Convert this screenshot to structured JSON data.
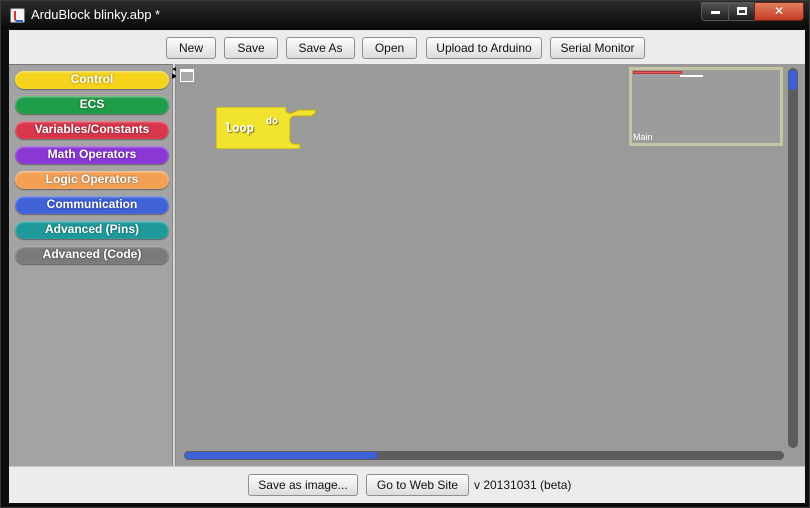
{
  "window": {
    "title": "ArduBlock blinky.abp *",
    "controls": {
      "minimize": "minimize-icon",
      "maximize": "maximize-icon",
      "close": "✕"
    }
  },
  "toolbar": {
    "new_label": "New",
    "save_label": "Save",
    "save_as_label": "Save As",
    "open_label": "Open",
    "upload_label": "Upload to Arduino",
    "serial_label": "Serial Monitor"
  },
  "palette": {
    "categories": [
      {
        "label": "Control",
        "color": "#f5d31a"
      },
      {
        "label": "ECS",
        "color": "#1f9c47"
      },
      {
        "label": "Variables/Constants",
        "color": "#d9354b"
      },
      {
        "label": "Math Operators",
        "color": "#8a37d6"
      },
      {
        "label": "Logic Operators",
        "color": "#f3a055"
      },
      {
        "label": "Communication",
        "color": "#3f62d9"
      },
      {
        "label": "Advanced (Pins)",
        "color": "#1e9a9a"
      },
      {
        "label": "Advanced (Code)",
        "color": "#7a7a7a"
      }
    ]
  },
  "canvas": {
    "block": {
      "keyword": "loop",
      "socket": "do",
      "color": "#f2e32e"
    },
    "minimap": {
      "label": "Main"
    }
  },
  "footer": {
    "save_image_label": "Save as image...",
    "website_label": "Go to Web Site",
    "version": "v 20131031 (beta)"
  }
}
